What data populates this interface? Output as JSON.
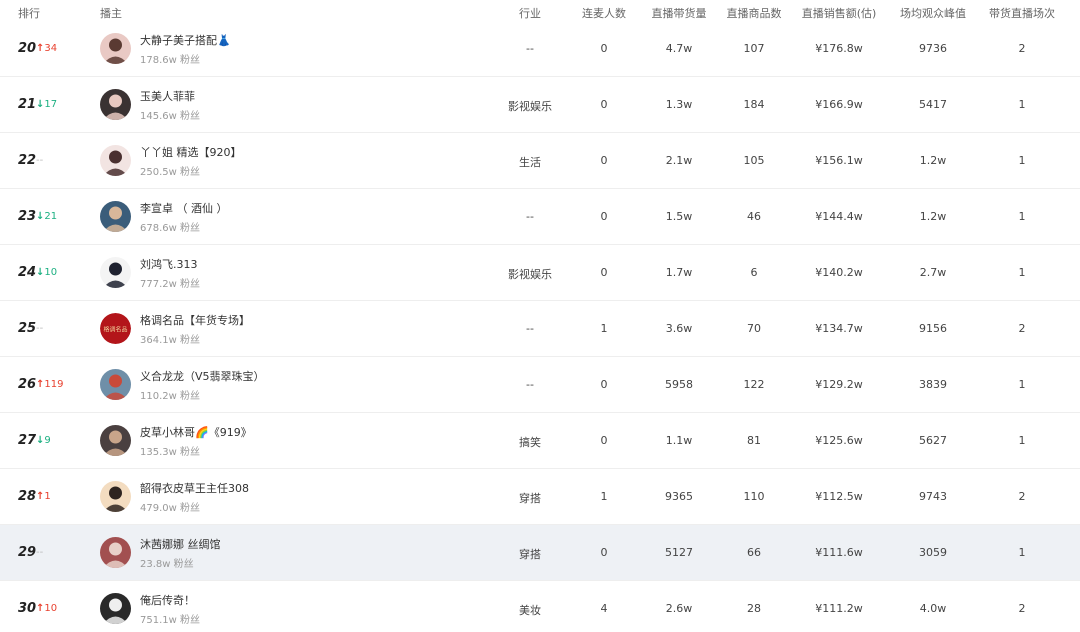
{
  "headers": {
    "rank": "排行",
    "host": "播主",
    "industry": "行业",
    "link_mic": "连麦人数",
    "goods_volume": "直播带货量",
    "product_count": "直播商品数",
    "sales": "直播销售额(估)",
    "peak_viewers": "场均观众峰值",
    "sessions": "带货直播场次"
  },
  "rows": [
    {
      "rank": "20",
      "trend": "up",
      "arrow": "↑",
      "change": "34",
      "name": "大静子美子搭配",
      "emoji": "👗",
      "fans": "178.6w 粉丝",
      "industry": "--",
      "link_mic": "0",
      "goods_volume": "4.7w",
      "product_count": "107",
      "sales": "¥176.8w",
      "peak_viewers": "9736",
      "sessions": "2",
      "avatar_bg": "#e9c9c4",
      "avatar_fg": "#5a3a32"
    },
    {
      "rank": "21",
      "trend": "down",
      "arrow": "↓",
      "change": "17",
      "name": "玉美人菲菲",
      "emoji": "",
      "fans": "145.6w 粉丝",
      "industry": "影视娱乐",
      "link_mic": "0",
      "goods_volume": "1.3w",
      "product_count": "184",
      "sales": "¥166.9w",
      "peak_viewers": "5417",
      "sessions": "1",
      "avatar_bg": "#3a3232",
      "avatar_fg": "#e8c8c0"
    },
    {
      "rank": "22",
      "trend": "same",
      "arrow": "",
      "change": "--",
      "name": "丫丫姐 精选【920】",
      "emoji": "",
      "fans": "250.5w 粉丝",
      "industry": "生活",
      "link_mic": "0",
      "goods_volume": "2.1w",
      "product_count": "105",
      "sales": "¥156.1w",
      "peak_viewers": "1.2w",
      "sessions": "1",
      "avatar_bg": "#f2e4e2",
      "avatar_fg": "#4a3030"
    },
    {
      "rank": "23",
      "trend": "down",
      "arrow": "↓",
      "change": "21",
      "name": "李宣卓 （ 酒仙 ）",
      "emoji": "",
      "fans": "678.6w 粉丝",
      "industry": "--",
      "link_mic": "0",
      "goods_volume": "1.5w",
      "product_count": "46",
      "sales": "¥144.4w",
      "peak_viewers": "1.2w",
      "sessions": "1",
      "avatar_bg": "#3b5d7a",
      "avatar_fg": "#d8b79a"
    },
    {
      "rank": "24",
      "trend": "down",
      "arrow": "↓",
      "change": "10",
      "name": "刘鸿飞.313",
      "emoji": "",
      "fans": "777.2w 粉丝",
      "industry": "影视娱乐",
      "link_mic": "0",
      "goods_volume": "1.7w",
      "product_count": "6",
      "sales": "¥140.2w",
      "peak_viewers": "2.7w",
      "sessions": "1",
      "avatar_bg": "#f4f4f4",
      "avatar_fg": "#1f2230"
    },
    {
      "rank": "25",
      "trend": "same",
      "arrow": "",
      "change": "--",
      "name": "格调名品【年货专场】",
      "emoji": "",
      "fans": "364.1w 粉丝",
      "industry": "--",
      "link_mic": "1",
      "goods_volume": "3.6w",
      "product_count": "70",
      "sales": "¥134.7w",
      "peak_viewers": "9156",
      "sessions": "2",
      "avatar_bg": "#b3151a",
      "avatar_fg": "#f3d9a0",
      "avatar_text": "格调名品"
    },
    {
      "rank": "26",
      "trend": "up",
      "arrow": "↑",
      "change": "119",
      "name": "义合龙龙（V5翡翠珠宝）",
      "emoji": "",
      "fans": "110.2w 粉丝",
      "industry": "--",
      "link_mic": "0",
      "goods_volume": "5958",
      "product_count": "122",
      "sales": "¥129.2w",
      "peak_viewers": "3839",
      "sessions": "1",
      "avatar_bg": "#6f8fa8",
      "avatar_fg": "#c94a3a"
    },
    {
      "rank": "27",
      "trend": "down",
      "arrow": "↓",
      "change": "9",
      "name": "皮草小林哥",
      "emoji": "🌈",
      "name_suffix": "《919》",
      "fans": "135.3w 粉丝",
      "industry": "搞笑",
      "link_mic": "0",
      "goods_volume": "1.1w",
      "product_count": "81",
      "sales": "¥125.6w",
      "peak_viewers": "5627",
      "sessions": "1",
      "avatar_bg": "#4a4040",
      "avatar_fg": "#c9a58a"
    },
    {
      "rank": "28",
      "trend": "up",
      "arrow": "↑",
      "change": "1",
      "name": "韶得衣皮草王主任308",
      "emoji": "",
      "fans": "479.0w 粉丝",
      "industry": "穿搭",
      "link_mic": "1",
      "goods_volume": "9365",
      "product_count": "110",
      "sales": "¥112.5w",
      "peak_viewers": "9743",
      "sessions": "2",
      "avatar_bg": "#f3dcc0",
      "avatar_fg": "#2e2420"
    },
    {
      "rank": "29",
      "trend": "same",
      "arrow": "",
      "change": "--",
      "name": "沐茜娜娜 丝绸馆",
      "emoji": "",
      "fans": "23.8w 粉丝",
      "industry": "穿搭",
      "link_mic": "0",
      "goods_volume": "5127",
      "product_count": "66",
      "sales": "¥111.6w",
      "peak_viewers": "3059",
      "sessions": "1",
      "avatar_bg": "#a25050",
      "avatar_fg": "#e8d0c8",
      "highlight": true
    },
    {
      "rank": "30",
      "trend": "up",
      "arrow": "↑",
      "change": "10",
      "name": "俺后传奇！",
      "emoji": "",
      "fans": "751.1w 粉丝",
      "industry": "美妆",
      "link_mic": "4",
      "goods_volume": "2.6w",
      "product_count": "28",
      "sales": "¥111.2w",
      "peak_viewers": "4.0w",
      "sessions": "2",
      "avatar_bg": "#2a2a2a",
      "avatar_fg": "#efefef"
    }
  ]
}
